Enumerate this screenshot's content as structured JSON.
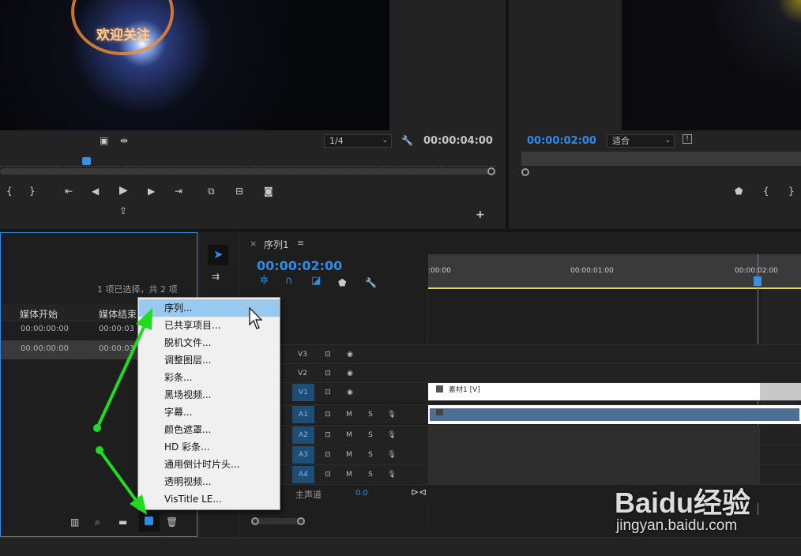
{
  "source_monitor": {
    "zoom": "1/4",
    "timecode": "00:00:04:00",
    "overlay_text": "欢迎关注"
  },
  "program_monitor": {
    "timecode": "00:00:02:00",
    "fit": "适合"
  },
  "project": {
    "selection": "1 项已选择，共 2 项",
    "columns": [
      "媒体开始",
      "媒体结束"
    ],
    "rows": [
      [
        "00:00:00:00",
        "00:00:03"
      ],
      [
        "00:00:00:00",
        "00:00:03"
      ]
    ]
  },
  "timeline": {
    "tab": "序列1",
    "timecode": "00:00:02:00",
    "ruler": [
      ":00:00",
      "00:00:01:00",
      "00:00:02:00"
    ],
    "tracks": [
      {
        "id": "V3"
      },
      {
        "id": "V2"
      },
      {
        "id": "V1"
      },
      {
        "id": "A1"
      },
      {
        "id": "A2"
      },
      {
        "id": "A3"
      },
      {
        "id": "A4"
      }
    ],
    "m": "M",
    "s": "S",
    "master_label": "主声道",
    "master_value": "0.0",
    "clip_label": "素材1 [V]"
  },
  "context_menu": {
    "items": [
      "序列...",
      "已共享项目...",
      "脱机文件...",
      "调整图层...",
      "彩条...",
      "黑场视频...",
      "字幕...",
      "颜色遮罩...",
      "HD 彩条...",
      "通用倒计时片头...",
      "透明视频...",
      "VisTitle LE..."
    ]
  },
  "watermark": {
    "brand": "Baidu经验",
    "url": "jingyan.baidu.com"
  },
  "colors": {
    "accent": "#2d8ceb",
    "menu_highlight": "#99c9ef",
    "arrow": "#1fdc1f",
    "playhead": "#3d8fe0"
  }
}
